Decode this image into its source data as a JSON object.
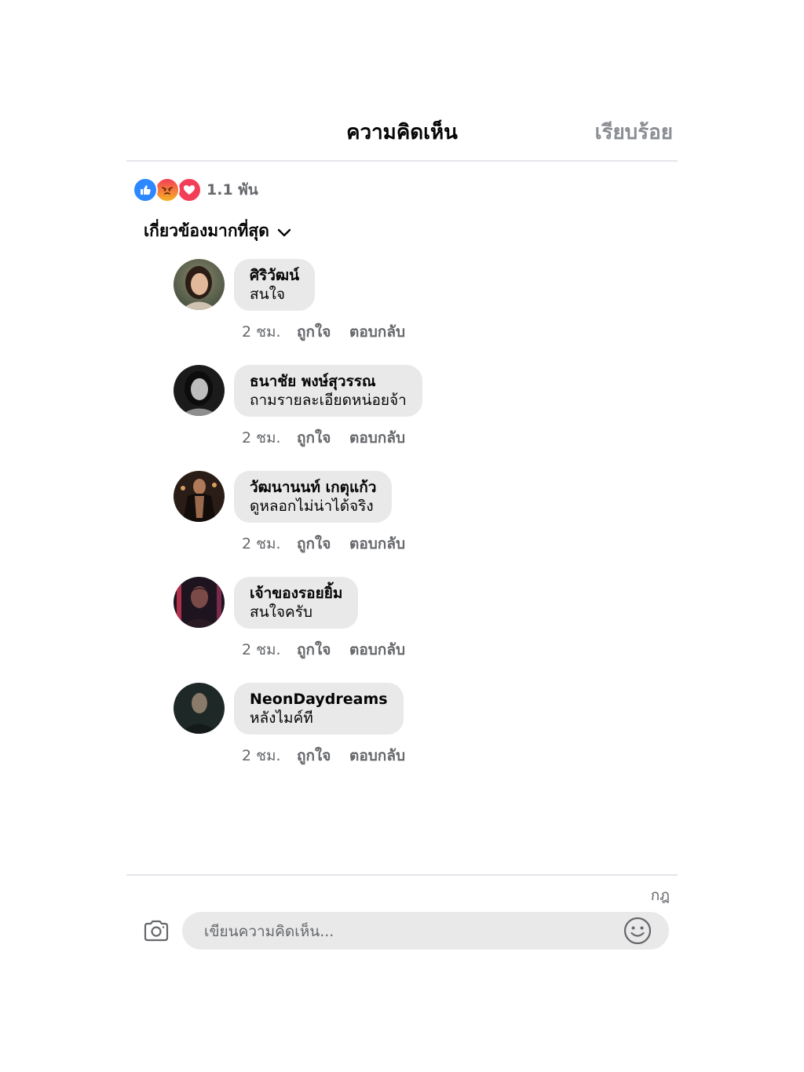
{
  "header": {
    "title": "ความคิดเห็น",
    "done_label": "เรียบร้อย"
  },
  "reactions": {
    "types": [
      "like-icon",
      "angry-icon",
      "love-icon"
    ],
    "count": "1.1 พัน"
  },
  "sort": {
    "label": "เกี่ยวข้องมากที่สุด"
  },
  "comments": [
    {
      "author": "ศิริวัฒน์",
      "text": "สนใจ",
      "time": "2 ชม.",
      "like_label": "ถูกใจ",
      "reply_label": "ตอบกลับ"
    },
    {
      "author": "ธนาชัย พงษ์สุวรรณ",
      "text": "ถามรายละเอียดหน่อยจ้า",
      "time": "2 ชม.",
      "like_label": "ถูกใจ",
      "reply_label": "ตอบกลับ"
    },
    {
      "author": "วัฒนานนท์ เกตุแก้ว",
      "text": "ดูหลอกไม่น่าได้จริง",
      "time": "2 ชม.",
      "like_label": "ถูกใจ",
      "reply_label": "ตอบกลับ"
    },
    {
      "author": "เจ้าของรอยยิ้ม",
      "text": "สนใจครับ",
      "time": "2 ชม.",
      "like_label": "ถูกใจ",
      "reply_label": "ตอบกลับ"
    },
    {
      "author": "NeonDaydreams",
      "text": "หลังไมค์ที",
      "time": "2 ชม.",
      "like_label": "ถูกใจ",
      "reply_label": "ตอบกลับ"
    }
  ],
  "footer": {
    "rules_label": "กฎ",
    "composer_placeholder": "เขียนความคิดเห็น..."
  },
  "colors": {
    "like": "#2d88ff",
    "love": "#f33e58",
    "bubble": "#e9e9ea",
    "muted": "#65676b"
  }
}
